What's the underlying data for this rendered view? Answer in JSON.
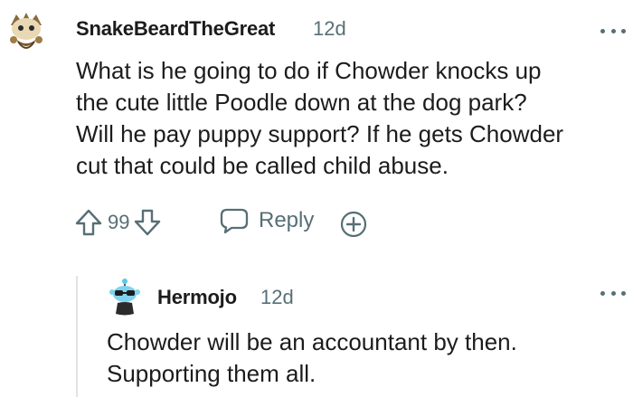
{
  "comment": {
    "username": "SnakeBeardTheGreat",
    "age": "12d",
    "body_lines": [
      "What is he going to do if Chowder knocks up",
      "the cute little Poodle down at the dog park?",
      "Will he pay puppy support? If he gets Chowder",
      "cut that could be called child abuse."
    ],
    "score": "99",
    "reply_label": "Reply",
    "avatar_icon": "snoo-bearded-avatar-icon",
    "more_icon": "more-options-icon"
  },
  "reply": {
    "username": "Hermojo",
    "age": "12d",
    "body_lines": [
      "Chowder will be an accountant by then.",
      "Supporting them all."
    ],
    "avatar_icon": "snoo-sunglasses-avatar-icon",
    "more_icon": "more-options-icon"
  },
  "colors": {
    "text": "#1c1c1c",
    "muted": "#576f76",
    "thread_line": "#e0e4e6"
  }
}
